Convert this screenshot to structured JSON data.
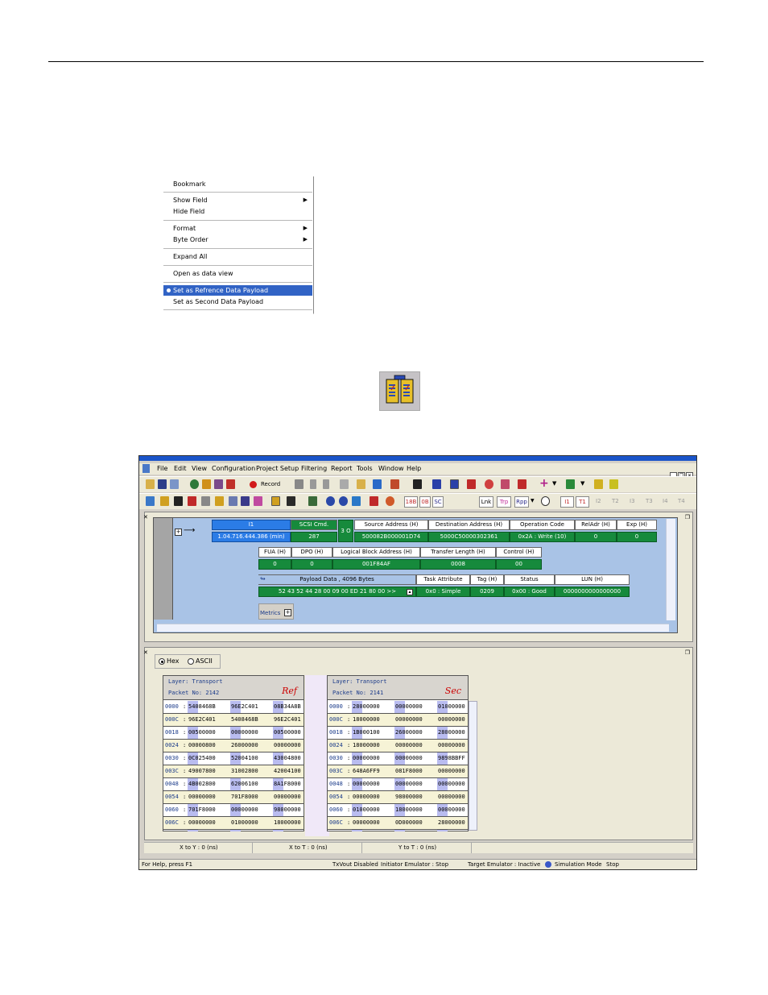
{
  "context_menu": {
    "items": [
      {
        "label": "Bookmark"
      },
      {
        "label": "Show Field",
        "submenu": true
      },
      {
        "label": "Hide Field"
      },
      {
        "label": "Format",
        "submenu": true
      },
      {
        "label": "Byte Order",
        "submenu": true
      },
      {
        "label": "Expand All"
      },
      {
        "label": "Open as data view"
      },
      {
        "label": "Set as Refrence Data Payload",
        "selected": true
      },
      {
        "label": "Set as Second Data Payload"
      }
    ]
  },
  "app": {
    "menus": [
      "File",
      "Edit",
      "View",
      "Configuration",
      "Project Setup",
      "Filtering",
      "Report",
      "Tools",
      "Window",
      "Help"
    ],
    "toolbar1": {
      "record_label": "Record"
    },
    "toolbar2": {
      "box1": "18B",
      "box2": "0B",
      "box3": "SC",
      "box4": "Lnk",
      "box5": "Trp",
      "box6": "Rpp",
      "i1": "I1",
      "t1": "T1",
      "i2": "I2",
      "t2": "T2",
      "i3": "I3",
      "t3": "T3",
      "i4": "I4",
      "t4": "T4"
    },
    "packet": {
      "row1_headers": [
        "I1",
        "SCSI Cmd.",
        "Source Address (H)",
        "Destination Address (H)",
        "Operation Code",
        "RelAdr (H)",
        "Exp (H)"
      ],
      "row1_values": [
        "1.04.716.444.386 (min)",
        "287",
        "500082B000001D74",
        "5000C50000302361",
        "0x2A : Write (10)",
        "0",
        "0"
      ],
      "sub_label": "3 O",
      "row2_headers": [
        "FUA (H)",
        "DPO (H)",
        "Logical Block Address (H)",
        "Transfer Length (H)",
        "Control (H)"
      ],
      "row2_values": [
        "0",
        "0",
        "001F84AF",
        "0008",
        "00"
      ],
      "row3_headers": [
        "Payload Data , 4096 Bytes",
        "Task Attribute",
        "Tag (H)",
        "Status",
        "LUN (H)"
      ],
      "row3_values": [
        "52 43 52 44 28 00 09 00 ED 21 80 00  >>",
        "0x0 : Simple",
        "0209",
        "0x00 : Good",
        "0000000000000000"
      ],
      "metrics_label": "Metrics"
    },
    "compare": {
      "radio_hex": "Hex",
      "radio_ascii": "ASCII",
      "ref": {
        "layer": "Layer: Transport",
        "packet": "Packet No: 2142",
        "tag": "Ref",
        "rows": [
          [
            "0000",
            "5408468B",
            "96E2C401",
            "08B34A8B"
          ],
          [
            "000C",
            "96E2C401",
            "5408468B",
            "96E2C401"
          ],
          [
            "0018",
            "00500000",
            "00000000",
            "00500000"
          ],
          [
            "0024",
            "00000800",
            "26000000",
            "00000000"
          ],
          [
            "0030",
            "0C025400",
            "52004100",
            "43004800"
          ],
          [
            "003C",
            "49007800",
            "31002800",
            "42004100"
          ],
          [
            "0048",
            "4B002800",
            "62006100",
            "8A1F8000"
          ],
          [
            "0054",
            "00000000",
            "701F8000",
            "00000000"
          ],
          [
            "0060",
            "701F8000",
            "00000000",
            "98000000"
          ],
          [
            "006C",
            "00000000",
            "01000000",
            "18000000"
          ]
        ]
      },
      "sec": {
        "layer": "Layer: Transport",
        "packet": "Packet No: 2141",
        "tag": "Sec",
        "rows": [
          [
            "0000",
            "28000000",
            "00000000",
            "01000000"
          ],
          [
            "000C",
            "18000000",
            "00000000",
            "00000000"
          ],
          [
            "0018",
            "1B000100",
            "26000000",
            "28000000"
          ],
          [
            "0024",
            "18000000",
            "00000000",
            "00000000"
          ],
          [
            "0030",
            "00000000",
            "00000000",
            "9898BBFF"
          ],
          [
            "003C",
            "648A6FF9",
            "081F8000",
            "00000000"
          ],
          [
            "0048",
            "00000000",
            "00000000",
            "00000000"
          ],
          [
            "0054",
            "00000000",
            "98000000",
            "00000000"
          ],
          [
            "0060",
            "01000000",
            "18000000",
            "00000000"
          ],
          [
            "006C",
            "00000000",
            "0D000000",
            "28000000"
          ]
        ]
      }
    },
    "measure": {
      "xy": "X to Y : 0 (ns)",
      "xt": "X to T : 0 (ns)",
      "yt": "Y to T : 0 (ns)"
    },
    "status": {
      "help": "For Help, press F1",
      "txvout": "TxVout Disabled",
      "init": "Initiator Emulator : Stop",
      "target": "Target Emulator : Inactive",
      "sim": "Simulation Mode",
      "stop": "Stop"
    }
  }
}
